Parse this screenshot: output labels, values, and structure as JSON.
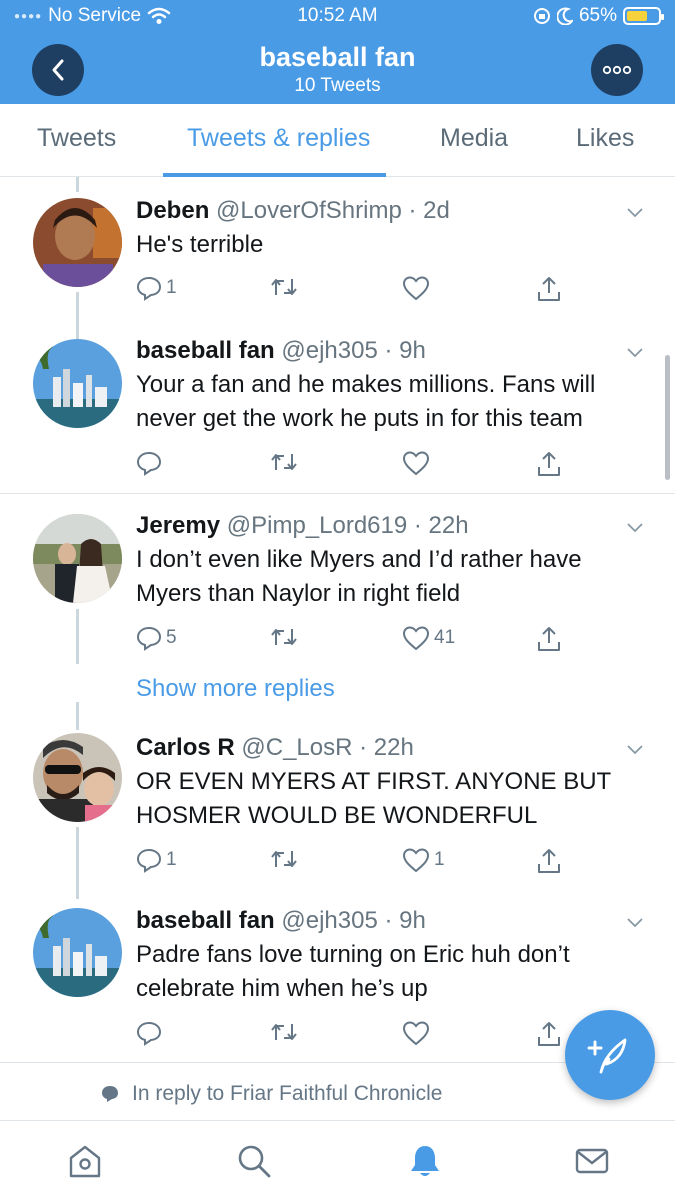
{
  "status_bar": {
    "carrier": "No Service",
    "time": "10:52 AM",
    "battery": "65%"
  },
  "header": {
    "title": "baseball fan",
    "subtitle": "10 Tweets"
  },
  "tabs": [
    {
      "label": "Tweets"
    },
    {
      "label": "Tweets & replies"
    },
    {
      "label": "Media"
    },
    {
      "label": "Likes"
    }
  ],
  "tweets": [
    {
      "name": "Deben",
      "handle": "@LoverOfShrimp",
      "time": "· 2d",
      "text": "He's terrible",
      "replies": "1",
      "likes": ""
    },
    {
      "name": "baseball fan",
      "handle": "@ejh305",
      "time": "· 9h",
      "text": "Your a fan and he makes millions. Fans will never get the work he puts in for this team",
      "replies": "",
      "likes": ""
    },
    {
      "name": "Jeremy",
      "handle": "@Pimp_Lord619",
      "time": "· 22h",
      "text": "I don’t even like Myers and I’d rather have Myers than Naylor in right field",
      "replies": "5",
      "likes": "41"
    },
    {
      "name": "Carlos R",
      "handle": "@C_LosR",
      "time": "· 22h",
      "text": "OR EVEN MYERS AT FIRST. ANYONE BUT HOSMER WOULD BE WONDERFUL",
      "replies": "1",
      "likes": "1"
    },
    {
      "name": "baseball fan",
      "handle": "@ejh305",
      "time": "· 9h",
      "text": "Padre fans love turning on Eric huh don’t celebrate him when he’s up",
      "replies": "",
      "likes": ""
    }
  ],
  "show_more": "Show more replies",
  "reply_context": "In reply to Friar Faithful Chronicle",
  "colors": {
    "accent": "#4a9be6",
    "header_button": "#1e3f62",
    "muted": "#657786"
  },
  "icons": [
    "back-chevron-icon",
    "more-dots-icon",
    "reply-icon",
    "retweet-icon",
    "like-icon",
    "share-icon",
    "compose-icon",
    "home-icon",
    "search-icon",
    "notifications-icon",
    "messages-icon"
  ]
}
